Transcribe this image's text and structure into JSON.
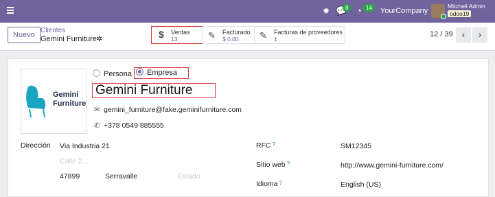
{
  "topbar": {
    "activity_badge": "14",
    "messages_badge": "8",
    "company": "YourCompany",
    "user_name": "Mitchell Admin",
    "database": "odoo19",
    "icons": [
      "menu-icon",
      "bug-icon",
      "chat-icon",
      "clock-icon"
    ]
  },
  "control": {
    "new_label": "Nuevo",
    "breadcrumb_parent": "Clientes",
    "breadcrumb_current": "Gemini Furniture",
    "pager": "12 / 39"
  },
  "smart_buttons": {
    "ventas": {
      "label": "Ventas",
      "value": "13"
    },
    "facturado": {
      "label": "Facturado",
      "value": "$ 0.00"
    },
    "proveedores": {
      "label": "Facturas de proveedores",
      "value": "1"
    }
  },
  "form": {
    "logo_line1": "Gemini",
    "logo_line2": "Furniture",
    "type_persona": "Persona",
    "type_empresa": "Empresa",
    "name": "Gemini Furniture",
    "email": "gemini_furniture@fake.geminifurniture.com",
    "phone": "+378 0549 885555",
    "address_label": "Dirección",
    "street": "Via Industria 21",
    "street2_placeholder": "Calle 2...",
    "zip": "47899",
    "city": "Serravalle",
    "state_placeholder": "Estado",
    "vat_label": "RFC",
    "vat": "SM12345",
    "website_label": "Sitio web",
    "website": "http://www.gemini-furniture.com/",
    "lang_label": "Idioma",
    "lang": "English (US)"
  },
  "colors": {
    "brand": "#71639e",
    "highlight": "#e0393e",
    "badge": "#28a745",
    "logo_teal": "#1aa6c2"
  }
}
